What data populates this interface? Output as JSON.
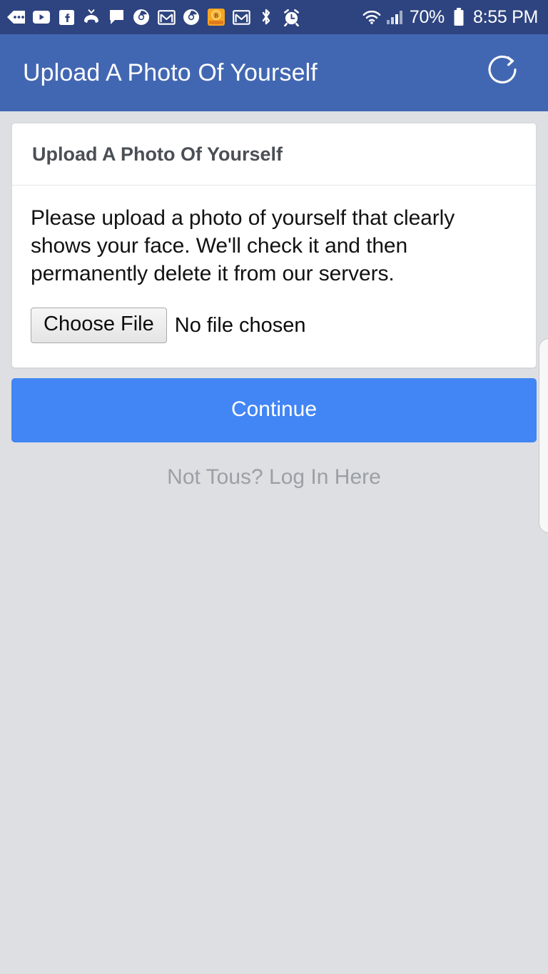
{
  "status_bar": {
    "background_color": "#2e4480",
    "notification_icons": [
      "more-notifications-icon",
      "youtube-icon",
      "facebook-icon",
      "missed-call-icon",
      "messenger-chat-icon",
      "chrome-icon",
      "gmail-icon",
      "chrome-icon-2",
      "coin-badge-icon",
      "gmail-icon-2",
      "bluetooth-icon",
      "alarm-clock-icon"
    ],
    "system_icons": [
      "wifi-icon",
      "cellular-signal-icon"
    ],
    "battery_percent": "70%",
    "time": "8:55 PM"
  },
  "app_header": {
    "title": "Upload A Photo Of Yourself",
    "background_color": "#4267b2",
    "refresh_icon": "refresh-icon"
  },
  "card": {
    "header_title": "Upload A Photo Of Yourself",
    "body_text": "Please upload a photo of yourself that clearly shows your face. We'll check it and then permanently delete it from our servers.",
    "file_input": {
      "button_label": "Choose File",
      "status_text": "No file chosen"
    }
  },
  "actions": {
    "continue_label": "Continue",
    "continue_color": "#4285f4",
    "login_link_label": "Not Tous? Log In Here"
  },
  "page": {
    "background_color": "#dddfe2"
  }
}
